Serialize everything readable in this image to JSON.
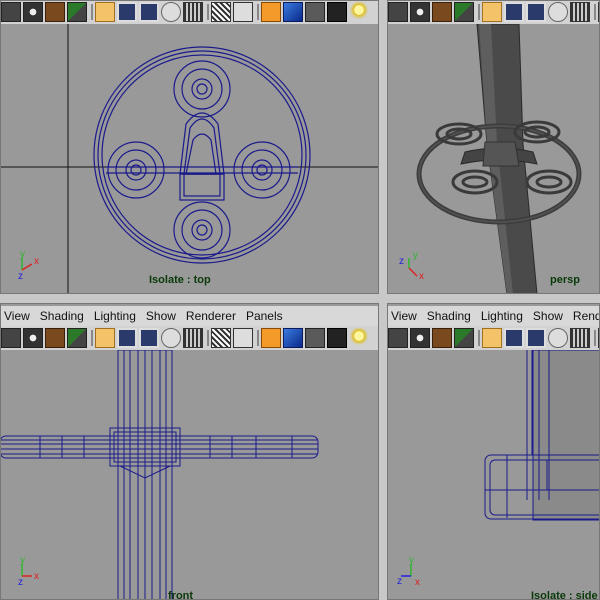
{
  "menus": {
    "items": [
      "View",
      "Shading",
      "Lighting",
      "Show",
      "Renderer",
      "Panels"
    ]
  },
  "panes": {
    "top": {
      "label": "Isolate : top"
    },
    "persp": {
      "label": "persp"
    },
    "front": {
      "label": "front"
    },
    "side": {
      "label": "Isolate : side"
    }
  },
  "axes": {
    "x": "x",
    "y": "y",
    "z": "z"
  },
  "toolbar_icons": [
    "select-camera-icon",
    "camera-attributes-icon",
    "bookmark-icon",
    "image-plane-icon",
    "grid-icon",
    "film-gate-icon",
    "resolution-gate-icon",
    "safe-action-icon",
    "pan-zoom-icon",
    "wireframe-icon",
    "texture-icon",
    "isolate-select-icon",
    "smooth-shade-icon",
    "flat-shade-icon",
    "bounding-box-icon",
    "light-bulb-icon"
  ],
  "colors": {
    "wire": "#1a1a8c",
    "viewport_bg": "#999999",
    "label": "#0a3a0a"
  }
}
